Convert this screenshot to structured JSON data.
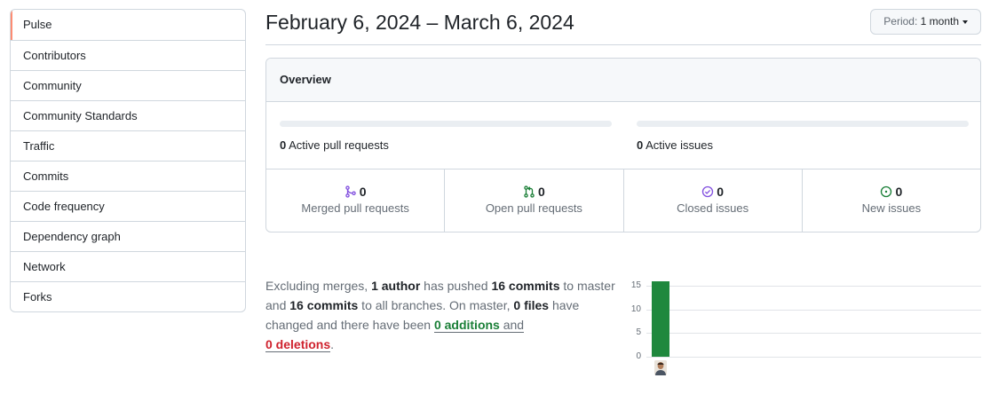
{
  "sidebar": {
    "items": [
      {
        "label": "Pulse",
        "active": true
      },
      {
        "label": "Contributors"
      },
      {
        "label": "Community"
      },
      {
        "label": "Community Standards"
      },
      {
        "label": "Traffic"
      },
      {
        "label": "Commits"
      },
      {
        "label": "Code frequency"
      },
      {
        "label": "Dependency graph"
      },
      {
        "label": "Network"
      },
      {
        "label": "Forks"
      }
    ]
  },
  "header": {
    "date_range": "February 6, 2024 – March 6, 2024",
    "period_prefix": "Period:",
    "period_value": "1 month"
  },
  "overview": {
    "title": "Overview",
    "active_prs_count": "0",
    "active_prs_label": "Active pull requests",
    "active_issues_count": "0",
    "active_issues_label": "Active issues",
    "stats": [
      {
        "count": "0",
        "label": "Merged pull requests",
        "icon": "git-merge-icon",
        "color": "#8250df"
      },
      {
        "count": "0",
        "label": "Open pull requests",
        "icon": "git-pull-request-icon",
        "color": "#1a7f37"
      },
      {
        "count": "0",
        "label": "Closed issues",
        "icon": "issue-closed-icon",
        "color": "#8250df"
      },
      {
        "count": "0",
        "label": "New issues",
        "icon": "issue-opened-icon",
        "color": "#1a7f37"
      }
    ]
  },
  "summary": {
    "t1": "Excluding merges, ",
    "authors": "1 author",
    "t2": " has pushed ",
    "commits_master": "16 commits",
    "t3": " to master and ",
    "commits_all": "16 commits",
    "t4": " to all branches. On master, ",
    "files": "0 files",
    "t5": " have changed and there have been ",
    "additions": "0 additions",
    "t6": " and",
    "deletions": "0 deletions",
    "t7": "."
  },
  "chart_data": {
    "type": "bar",
    "categories": [
      "1 author"
    ],
    "values": [
      16
    ],
    "yticks": [
      "15",
      "10",
      "5",
      "0"
    ],
    "ylim": [
      0,
      16
    ],
    "bar_color": "#1f883d"
  }
}
